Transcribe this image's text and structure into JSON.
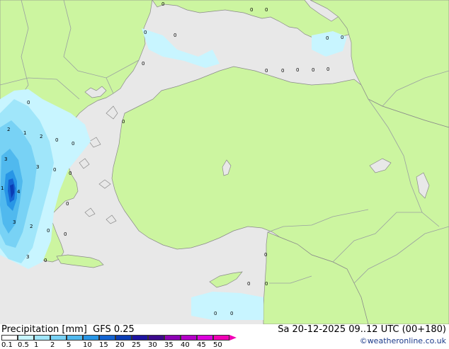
{
  "title": "Precipitation [mm]  GFS 0.25",
  "run": "Sa 20-12-2025 09..12 UTC (00+180)",
  "credit": "©weatheronline.co.uk",
  "legend": {
    "ticks": [
      "0.1",
      "0.5",
      "1",
      "2",
      "5",
      "10",
      "15",
      "20",
      "25",
      "30",
      "35",
      "40",
      "45",
      "50"
    ],
    "colors": [
      "#ffffff",
      "#c8f5ff",
      "#a0e6fa",
      "#78d2f5",
      "#50b9ee",
      "#2896e6",
      "#1464d2",
      "#0a3cb4",
      "#1e14a0",
      "#3c0a8c",
      "#8c00b4",
      "#b400c8",
      "#dc00dc",
      "#f000b4"
    ]
  },
  "colors": {
    "sea": "#e8e8e8",
    "land": "#ccf5a0",
    "border": "#9aa0a0",
    "coast": "#8a8a8a"
  },
  "map_labels": [
    "0",
    "0",
    "0",
    "0",
    "0",
    "0",
    "0",
    "0",
    "0",
    "0",
    "0",
    "0",
    "0",
    "2",
    "1",
    "2",
    "0",
    "0",
    "3",
    "3",
    "0",
    "0",
    "1",
    "4",
    "0",
    "3",
    "2",
    "0",
    "0",
    "3",
    "0",
    "0",
    "0",
    "0",
    "0",
    "0",
    "0",
    "0"
  ]
}
